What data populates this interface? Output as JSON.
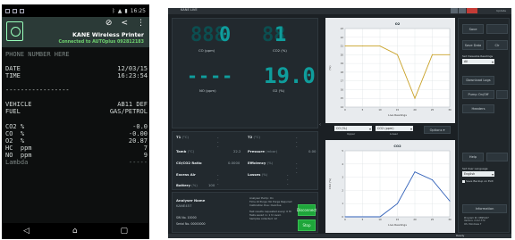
{
  "phone": {
    "status_time": "16:25",
    "app_title": "KANE Wireless Printer",
    "connection": "Connected to AUTOplus 092812183",
    "receipt_top": "PHONE NUMBER HERE",
    "receipt_header_faded": "",
    "date_label": "DATE",
    "date_value": "12/03/15",
    "time_label": "TIME",
    "time_value": "16:23:54",
    "divider": "-----------------",
    "vehicle_label": "VEHICLE",
    "vehicle_value": "AB11 DEF",
    "fuel_label": "FUEL",
    "fuel_value": "GAS/PETROL",
    "readings": [
      {
        "label": "CO2 %",
        "value": "-0.0"
      },
      {
        "label": "CO  %",
        "value": "-0.00"
      },
      {
        "label": "O2  %",
        "value": "20.87"
      },
      {
        "label": "HC  ppm",
        "value": "7"
      },
      {
        "label": "NO  ppm",
        "value": "9"
      },
      {
        "label": "Lambda",
        "value": "-----"
      }
    ],
    "nav": {
      "back": "◁",
      "home": "⌂",
      "recent": "▢"
    }
  },
  "window": {
    "title": "KANE LIVE",
    "top_right_text": "Update",
    "readouts": [
      {
        "id": "co",
        "value": "0",
        "label": "CO",
        "unit": "(ppm)",
        "dim_digits": "888"
      },
      {
        "id": "co2",
        "value": "1",
        "label": "CO2",
        "unit": "(%)",
        "dim_digits": "88"
      },
      {
        "id": "no",
        "value": "----",
        "label": "NO",
        "unit": "(ppm)"
      },
      {
        "id": "o2",
        "value": "19.0",
        "label": "O2",
        "unit": "(%)"
      }
    ],
    "params": [
      {
        "label": "T1",
        "unit": "(°C)",
        "value": "---"
      },
      {
        "label": "T2",
        "unit": "(°C)",
        "value": "---"
      },
      {
        "label": "Tamb",
        "unit": "(°C)",
        "value": "22.2"
      },
      {
        "label": "Pressure",
        "unit": "(mbar)",
        "value": "0.00"
      },
      {
        "label": "CO/CO2 Ratio",
        "unit": "",
        "value": "0.0000"
      },
      {
        "label": "Efficiency",
        "unit": "(%)",
        "value": "---"
      },
      {
        "label": "Excess Air",
        "unit": "",
        "value": "---"
      },
      {
        "label": "Losses",
        "unit": "(%)",
        "value": "---"
      },
      {
        "label": "Battery",
        "unit": "(%)",
        "value": "100"
      }
    ],
    "analyser": {
      "name_label": "Analyser Name",
      "name_value": "KANE457",
      "sw_label": "SW No.",
      "sw_value": "10000",
      "serial_label": "Serial No.",
      "serial_value": "00000000",
      "status_lines": [
        "Analyser Pump: On",
        "Time At Purge: No Purge Required",
        "Calibration Due: Overdue",
        "",
        "Test results requested every: 0 Hr",
        "Tests saved in: 1 hr avail.",
        "Samples collected: 12"
      ]
    },
    "buttons": {
      "disconnect": "Disconnect",
      "stop": "Stop",
      "options": "Options ▾"
    },
    "dropdowns": {
      "upper": "CO (%)",
      "upper_caption": "Upper",
      "lower": "CO2 (ppm)",
      "lower_caption": "Lower"
    },
    "chart_titles": {
      "upper": "O2",
      "lower": "CO2"
    },
    "sidebar": {
      "btn1": "Save",
      "btn2": "Save Data",
      "btn3": "Clr",
      "readings_label": "Set Viewable Readings",
      "readings_value": "All",
      "download_logs": "Download Logs",
      "pump_onoff": "Pump On/Off",
      "headers": "Headers",
      "help": "Help",
      "language_label": "Set User Language",
      "language_value": "English",
      "autoload_label": "Save Backup on Exit",
      "information": "Information",
      "info_lines": [
        "Program ID: 0895167",
        "Version: 2.0.2.772",
        "OS: Windows 7"
      ]
    },
    "bottom_status": "Ready"
  },
  "chart_data": [
    {
      "type": "line",
      "title": "O2",
      "xlabel": "Live Readings",
      "ylabel": "(%)",
      "x": [
        0,
        5,
        10,
        15,
        20,
        25,
        30
      ],
      "x_ticks": [
        "0",
        "5",
        "10",
        "15",
        "20",
        "25",
        "30"
      ],
      "series": [
        {
          "values": [
            21.0,
            21.0,
            21.0,
            20.0,
            15.0,
            20.0,
            20.0
          ]
        }
      ],
      "ylim": [
        14,
        23
      ],
      "y_ticks": [
        "14",
        "15",
        "16",
        "17",
        "18",
        "19",
        "20",
        "21",
        "22",
        "23"
      ],
      "color": "#c9a227",
      "grid": true
    },
    {
      "type": "line",
      "title": "CO2",
      "xlabel": "Live Readings",
      "ylabel": "CO2 (%)",
      "x": [
        0,
        5,
        10,
        15,
        20,
        25,
        30
      ],
      "x_ticks": [
        "0",
        "5",
        "10",
        "15",
        "20",
        "25",
        "30"
      ],
      "series": [
        {
          "values": [
            0.0,
            0.0,
            0.0,
            1.0,
            3.4,
            2.8,
            1.2
          ]
        }
      ],
      "ylim": [
        0,
        5
      ],
      "y_ticks": [
        "0",
        "1",
        "2",
        "3",
        "4",
        "5"
      ],
      "color": "#2f5fb8",
      "grid": true
    }
  ]
}
